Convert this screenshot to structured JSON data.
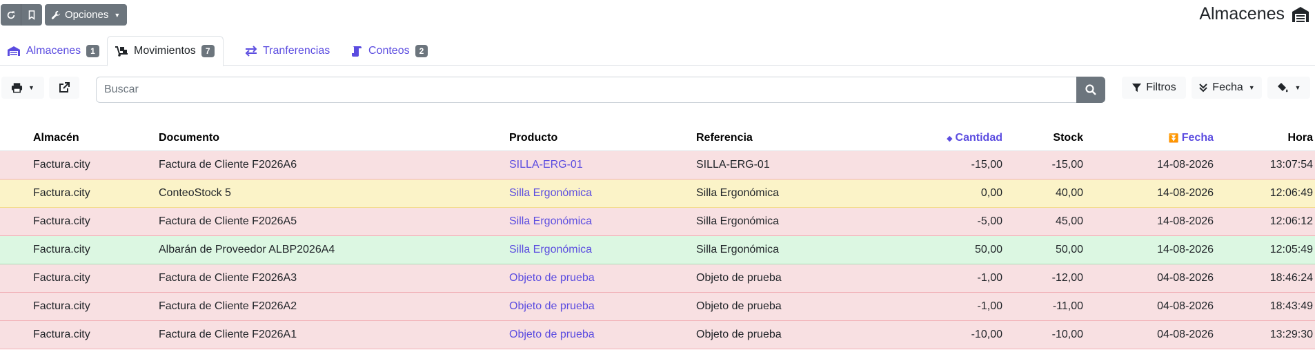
{
  "app": {
    "title": "Almacenes"
  },
  "topbar": {
    "refresh_icon": "refresh-icon",
    "bookmark_icon": "bookmark-icon",
    "options_label": "Opciones"
  },
  "tabs": [
    {
      "label": "Almacenes",
      "badge": "1",
      "icon": "warehouse-icon",
      "active": false
    },
    {
      "label": "Movimientos",
      "badge": "7",
      "icon": "dolly-icon",
      "active": true
    },
    {
      "label": "Tranferencias",
      "badge": "",
      "icon": "exchange-icon",
      "active": false
    },
    {
      "label": "Conteos",
      "badge": "2",
      "icon": "scroll-icon",
      "active": false
    }
  ],
  "toolbar": {
    "search_placeholder": "Buscar",
    "filters_label": "Filtros",
    "sort_label": "Fecha"
  },
  "table": {
    "columns": [
      "Almacén",
      "Documento",
      "Producto",
      "Referencia",
      "Cantidad",
      "Stock",
      "Fecha",
      "Hora"
    ],
    "rows": [
      {
        "status": "danger",
        "cells": [
          "Factura.city",
          "Factura de Cliente F2026A6",
          "SILLA-ERG-01",
          "SILLA-ERG-01",
          "-15,00",
          "-15,00",
          "14-08-2026",
          "13:07:54"
        ]
      },
      {
        "status": "warning",
        "cells": [
          "Factura.city",
          "ConteoStock 5",
          "Silla Ergonómica",
          "Silla Ergonómica",
          "0,00",
          "40,00",
          "14-08-2026",
          "12:06:49"
        ]
      },
      {
        "status": "danger",
        "cells": [
          "Factura.city",
          "Factura de Cliente F2026A5",
          "Silla Ergonómica",
          "Silla Ergonómica",
          "-5,00",
          "45,00",
          "14-08-2026",
          "12:06:12"
        ]
      },
      {
        "status": "success",
        "cells": [
          "Factura.city",
          "Albarán de Proveedor ALBP2026A4",
          "Silla Ergonómica",
          "Silla Ergonómica",
          "50,00",
          "50,00",
          "14-08-2026",
          "12:05:49"
        ]
      },
      {
        "status": "danger",
        "cells": [
          "Factura.city",
          "Factura de Cliente F2026A3",
          "Objeto de prueba",
          "Objeto de prueba",
          "-1,00",
          "-12,00",
          "04-08-2026",
          "18:46:24"
        ]
      },
      {
        "status": "danger",
        "cells": [
          "Factura.city",
          "Factura de Cliente F2026A2",
          "Objeto de prueba",
          "Objeto de prueba",
          "-1,00",
          "-11,00",
          "04-08-2026",
          "18:43:49"
        ]
      },
      {
        "status": "danger",
        "cells": [
          "Factura.city",
          "Factura de Cliente F2026A1",
          "Objeto de prueba",
          "Objeto de prueba",
          "-10,00",
          "-10,00",
          "04-08-2026",
          "13:29:30"
        ]
      }
    ]
  },
  "colors": {
    "accent": "#5b4ce0",
    "danger_row": "#f8e0e2",
    "warning_row": "#fbf3c8",
    "success_row": "#dcf7e2",
    "secondary_button": "#6c757d"
  }
}
